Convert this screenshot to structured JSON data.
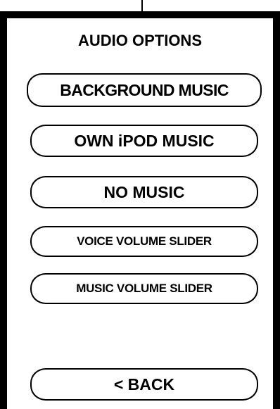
{
  "screen": {
    "title": "AUDIO OPTIONS"
  },
  "options": {
    "background_music": "BACKGROUND MUSIC",
    "own_ipod_music": "OWN iPOD MUSIC",
    "no_music": "NO MUSIC",
    "voice_volume_slider": "VOICE VOLUME SLIDER",
    "music_volume_slider": "MUSIC VOLUME SLIDER"
  },
  "navigation": {
    "back": "< BACK"
  },
  "colors": {
    "ink": "#000000",
    "background": "#ffffff"
  }
}
